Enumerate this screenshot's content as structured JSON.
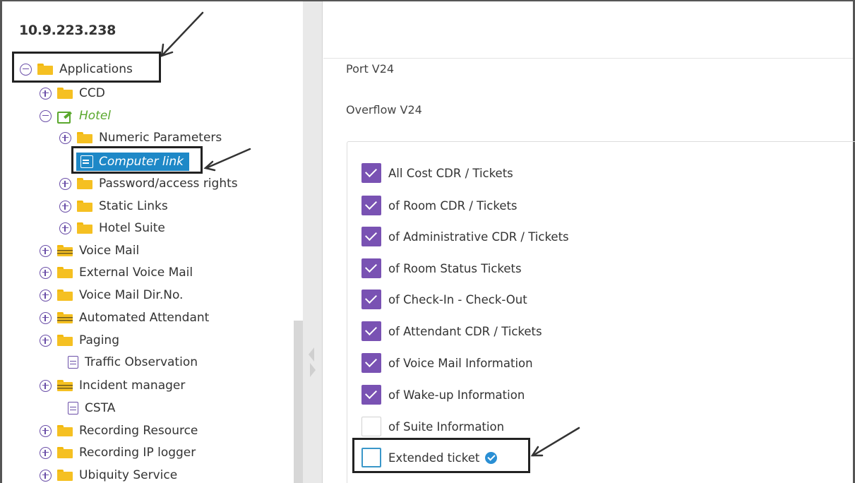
{
  "tree": {
    "ip": "10.9.223.238",
    "nodes": [
      {
        "label": "Applications"
      },
      {
        "label": "CCD"
      },
      {
        "label": "Hotel"
      },
      {
        "label": "Numeric Parameters"
      },
      {
        "label": "Computer link"
      },
      {
        "label": "Password/access rights"
      },
      {
        "label": "Static Links"
      },
      {
        "label": "Hotel Suite"
      },
      {
        "label": "Voice Mail"
      },
      {
        "label": "External Voice Mail"
      },
      {
        "label": "Voice Mail Dir.No."
      },
      {
        "label": "Automated Attendant"
      },
      {
        "label": "Paging"
      },
      {
        "label": "Traffic Observation"
      },
      {
        "label": "Incident manager"
      },
      {
        "label": "CSTA"
      },
      {
        "label": "Recording Resource"
      },
      {
        "label": "Recording IP logger"
      },
      {
        "label": "Ubiquity Service"
      }
    ]
  },
  "form": {
    "port_label": "Port V24",
    "overflow_label": "Overflow V24",
    "checkboxes": [
      {
        "label": "All Cost CDR / Tickets",
        "checked": true
      },
      {
        "label": "of Room CDR / Tickets",
        "checked": true
      },
      {
        "label": "of Administrative CDR / Tickets",
        "checked": true
      },
      {
        "label": "of Room Status Tickets",
        "checked": true
      },
      {
        "label": "of Check-In - Check-Out",
        "checked": true
      },
      {
        "label": "of Attendant CDR / Tickets",
        "checked": true
      },
      {
        "label": "of Voice Mail Information",
        "checked": true
      },
      {
        "label": "of Wake-up Information",
        "checked": true
      },
      {
        "label": "of Suite Information",
        "checked": false
      },
      {
        "label": "Extended ticket",
        "checked": false
      }
    ]
  },
  "colors": {
    "accent_purple": "#7952b3",
    "selection_blue": "#1e88c7",
    "hotel_green": "#5ba82e",
    "folder_yellow": "#f5c022"
  }
}
